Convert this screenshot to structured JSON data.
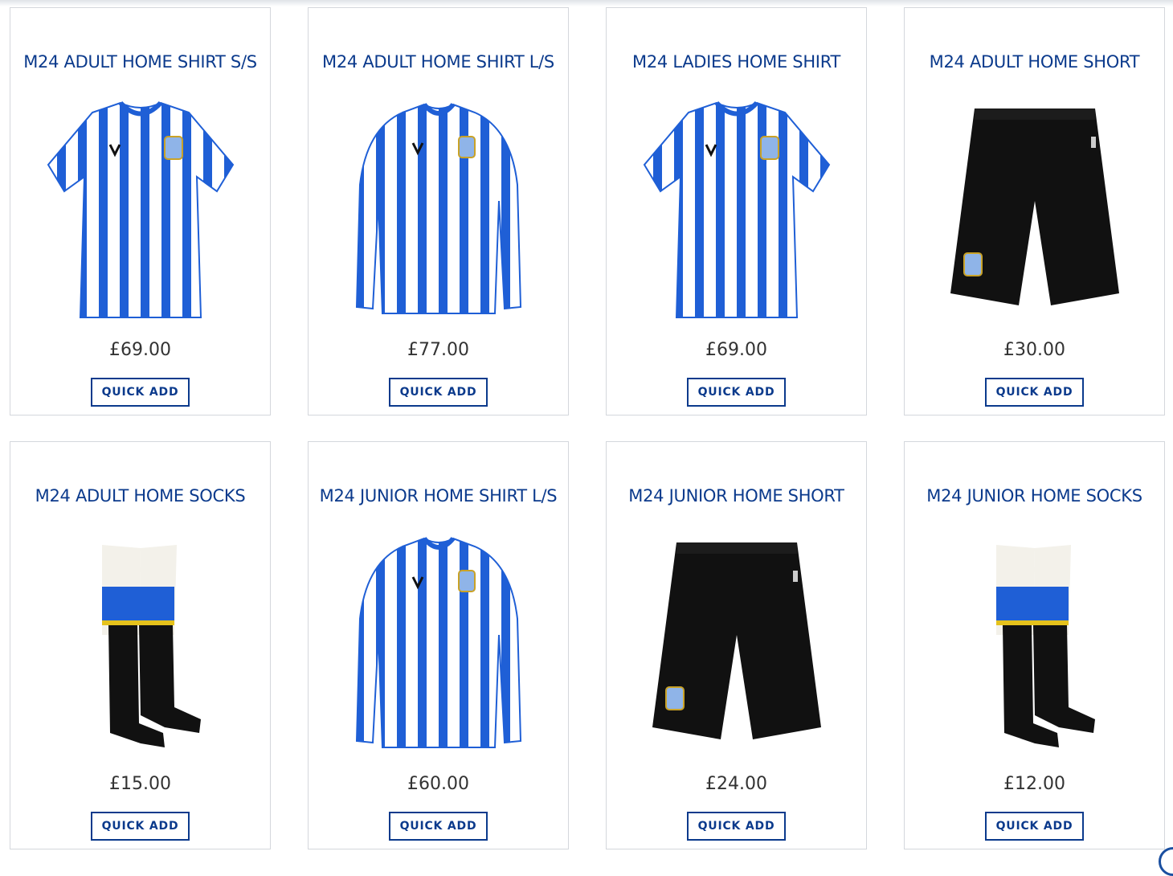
{
  "products": [
    {
      "title": "M24 ADULT HOME SHIRT S/S",
      "price": "£69.00",
      "button": "QUICK ADD",
      "image": "shirt-short-sleeve"
    },
    {
      "title": "M24 ADULT HOME SHIRT L/S",
      "price": "£77.00",
      "button": "QUICK ADD",
      "image": "shirt-long-sleeve"
    },
    {
      "title": "M24 LADIES HOME SHIRT",
      "price": "£69.00",
      "button": "QUICK ADD",
      "image": "shirt-short-sleeve"
    },
    {
      "title": "M24 ADULT HOME SHORT",
      "price": "£30.00",
      "button": "QUICK ADD",
      "image": "shorts"
    },
    {
      "title": "M24 ADULT HOME SOCKS",
      "price": "£15.00",
      "button": "QUICK ADD",
      "image": "socks"
    },
    {
      "title": "M24 JUNIOR HOME SHIRT L/S",
      "price": "£60.00",
      "button": "QUICK ADD",
      "image": "shirt-long-sleeve"
    },
    {
      "title": "M24 JUNIOR HOME SHORT",
      "price": "£24.00",
      "button": "QUICK ADD",
      "image": "shorts"
    },
    {
      "title": "M24 JUNIOR HOME SOCKS",
      "price": "£12.00",
      "button": "QUICK ADD",
      "image": "socks"
    }
  ],
  "colors": {
    "brand_blue": "#0b3a8c",
    "stripe_blue": "#1f5fd6",
    "shorts_black": "#111111"
  }
}
